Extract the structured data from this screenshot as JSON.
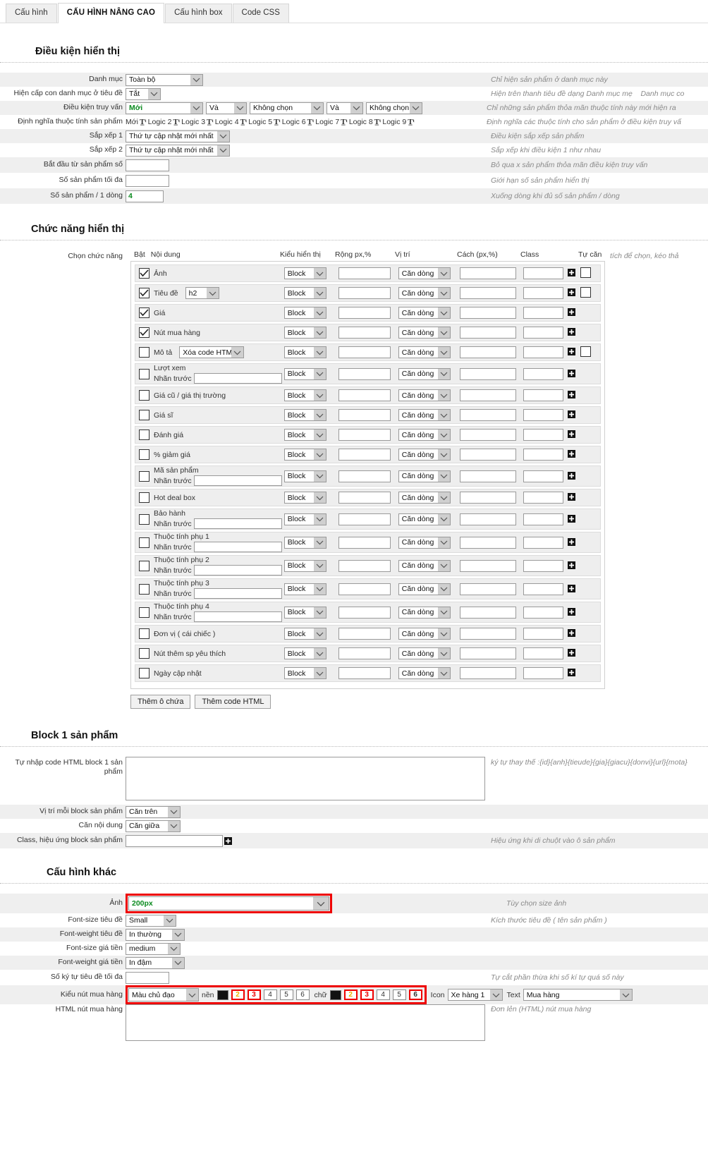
{
  "tabs": [
    {
      "label": "Cấu hình",
      "active": false
    },
    {
      "label": "CẤU HÌNH NÂNG CAO",
      "active": true
    },
    {
      "label": "Cấu hình box",
      "active": false
    },
    {
      "label": "Code CSS",
      "active": false
    }
  ],
  "sections": {
    "display_conditions": {
      "title": "Điều kiện hiển thị",
      "rows": {
        "category": {
          "label": "Danh mục",
          "value": "Toàn bộ",
          "hint": "Chỉ hiện sản phẩm ở danh mục này"
        },
        "subcat": {
          "label": "Hiện cấp con danh mục ở tiêu đề",
          "value": "Tắt",
          "hint": "Hiện trên thanh tiêu đề dạng Danh mục mẹ",
          "hint2": "Danh mục co"
        },
        "query": {
          "label": "Điều kiện truy vấn",
          "v1": "Mới",
          "op1": "Và",
          "v2": "Không chọn",
          "op2": "Và",
          "v3": "Không chọn",
          "hint": "Chỉ những sản phẩm thỏa mãn thuộc tính này mới hiện ra"
        },
        "attrdef": {
          "label": "Định nghĩa thuộc tính sản phẩm",
          "items": [
            "Mới",
            "Logic 2",
            "Logic 3",
            "Logic 4",
            "Logic 5",
            "Logic 6",
            "Logic 7",
            "Logic 8",
            "Logic 9"
          ],
          "hint": "Định nghĩa các thuộc tính cho sản phẩm ở điều kiện truy vấ"
        },
        "sort1": {
          "label": "Sắp xếp 1",
          "value": "Thứ tự cập nhật mới nhất",
          "hint": "Điều kiện sắp xếp sản phẩm"
        },
        "sort2": {
          "label": "Sắp xếp 2",
          "value": "Thứ tự cập nhật mới nhất",
          "hint": "Sắp xếp khi điều kiện 1 như nhau"
        },
        "startfrom": {
          "label": "Bắt đầu từ sản phẩm số",
          "value": "",
          "hint": "Bỏ qua x sản phẩm thỏa mãn điều kiện truy vấn"
        },
        "maxprod": {
          "label": "Số sản phẩm tối đa",
          "value": "",
          "hint": "Giới hạn số sản phẩm hiển thị"
        },
        "perrow": {
          "label": "Số sản phẩm / 1 dòng",
          "value": "4",
          "hint": "Xuống dòng khi đủ số sản phẩm / dòng"
        }
      }
    },
    "display_features": {
      "title": "Chức năng hiển thị",
      "row_label": "Chọn chức năng",
      "right_hint": "tích để chọn, kéo thả",
      "headers": [
        "Bật",
        "Nội dung",
        "Kiểu hiển thị",
        "Rộng px,%",
        "Vị trí",
        "Cách (px,%)",
        "Class",
        "Tự căn"
      ],
      "prefix_label": "Nhãn trước",
      "default_display": "Block",
      "default_position": "Căn dòng",
      "items": [
        {
          "name": "Ảnh",
          "checked": true,
          "has_prefix": false,
          "has_autoalign": true
        },
        {
          "name": "Tiêu đề",
          "checked": true,
          "has_prefix": false,
          "has_autoalign": true,
          "inline_select": "h2"
        },
        {
          "name": "Giá",
          "checked": true,
          "has_prefix": false,
          "has_autoalign": false
        },
        {
          "name": "Nút mua hàng",
          "checked": true,
          "has_prefix": false,
          "has_autoalign": false
        },
        {
          "name": "Mô tả",
          "checked": false,
          "has_prefix": false,
          "has_autoalign": true,
          "inline_select": "Xóa code HTML"
        },
        {
          "name": "Lượt xem",
          "checked": false,
          "has_prefix": true,
          "has_autoalign": false
        },
        {
          "name": "Giá cũ / giá thị trường",
          "checked": false,
          "has_prefix": false,
          "has_autoalign": false
        },
        {
          "name": "Giá sĩ",
          "checked": false,
          "has_prefix": false,
          "has_autoalign": false
        },
        {
          "name": "Đánh giá",
          "checked": false,
          "has_prefix": false,
          "has_autoalign": false
        },
        {
          "name": "% giảm giá",
          "checked": false,
          "has_prefix": false,
          "has_autoalign": false
        },
        {
          "name": "Mã sản phẩm",
          "checked": false,
          "has_prefix": true,
          "has_autoalign": false
        },
        {
          "name": "Hot deal box",
          "checked": false,
          "has_prefix": false,
          "has_autoalign": false
        },
        {
          "name": "Bảo hành",
          "checked": false,
          "has_prefix": true,
          "has_autoalign": false
        },
        {
          "name": "Thuộc tính phụ 1",
          "checked": false,
          "has_prefix": true,
          "has_autoalign": false
        },
        {
          "name": "Thuộc tính phụ 2",
          "checked": false,
          "has_prefix": true,
          "has_autoalign": false
        },
        {
          "name": "Thuộc tính phụ 3",
          "checked": false,
          "has_prefix": true,
          "has_autoalign": false
        },
        {
          "name": "Thuộc tính phụ 4",
          "checked": false,
          "has_prefix": true,
          "has_autoalign": false
        },
        {
          "name": "Đơn vị ( cái chiếc )",
          "checked": false,
          "has_prefix": false,
          "has_autoalign": false
        },
        {
          "name": "Nút thêm sp yêu thích",
          "checked": false,
          "has_prefix": false,
          "has_autoalign": false
        },
        {
          "name": "Ngày cập nhật",
          "checked": false,
          "has_prefix": false,
          "has_autoalign": false
        }
      ],
      "buttons": [
        {
          "label": "Thêm ô chứa"
        },
        {
          "label": "Thêm code HTML"
        }
      ]
    },
    "block1": {
      "title": "Block 1 sản phẩm",
      "html_label": "Tự nhập code HTML block 1 sản phẩm",
      "html_value": "",
      "html_hint": "ký tự thay thế :{id}{anh}{tieude}{gia}{giacu}{donvi}{url}{mota}",
      "pos_label": "Vị trí mỗi block sản phẩm",
      "pos_value": "Căn trên",
      "align_label": "Căn nội dung",
      "align_value": "Căn giữa",
      "class_label": "Class, hiệu ứng block sản phẩm",
      "class_value": "",
      "class_hint": "Hiệu ứng khi di chuột vào ô sản phẩm"
    },
    "other": {
      "title": "Cấu hình khác",
      "img_label": "Ảnh",
      "img_value": "200px",
      "img_hint": "Tùy chọn size ảnh",
      "fs_title_label": "Font-size tiêu đề",
      "fs_title_value": "Small",
      "fs_title_hint": "Kích thước tiêu đề ( tên sản phẩm )",
      "fw_title_label": "Font-weight tiêu đề",
      "fw_title_value": "In thường",
      "fs_price_label": "Font-size giá tiền",
      "fs_price_value": "medium",
      "fw_price_label": "Font-weight giá tiền",
      "fw_price_value": "In đậm",
      "maxchar_label": "Số ký tự tiêu đề tối đa",
      "maxchar_value": "",
      "maxchar_hint": "Tự cắt phần thừa khi số kí tự quá số này",
      "btnstyle_label": "Kiểu nút mua hàng",
      "btnstyle_value": "Màu chủ đạo",
      "bg_label": "nền",
      "bg_color": "#111111",
      "bg_numbers": [
        "2",
        "3",
        "4",
        "5",
        "6"
      ],
      "bg_selected": [
        "2",
        "3"
      ],
      "text_label": "chữ",
      "text_color": "#111111",
      "text_numbers": [
        "2",
        "3",
        "4",
        "5",
        "6"
      ],
      "text_selected": [
        "2",
        "3",
        "6"
      ],
      "text_colored": {
        "2": "#f0b000",
        "3": "#ee0000"
      },
      "bg_colored": {
        "2": "#f0b000",
        "3": "#ee0000"
      },
      "icon_label": "Icon",
      "icon_value": "Xe hàng 1",
      "text_field_label": "Text",
      "text_field_value": "Mua hàng",
      "html_btn_label": "HTML nút mua hàng",
      "html_btn_hint": "Đơn lẻn (HTML) nút mua hàng"
    }
  }
}
